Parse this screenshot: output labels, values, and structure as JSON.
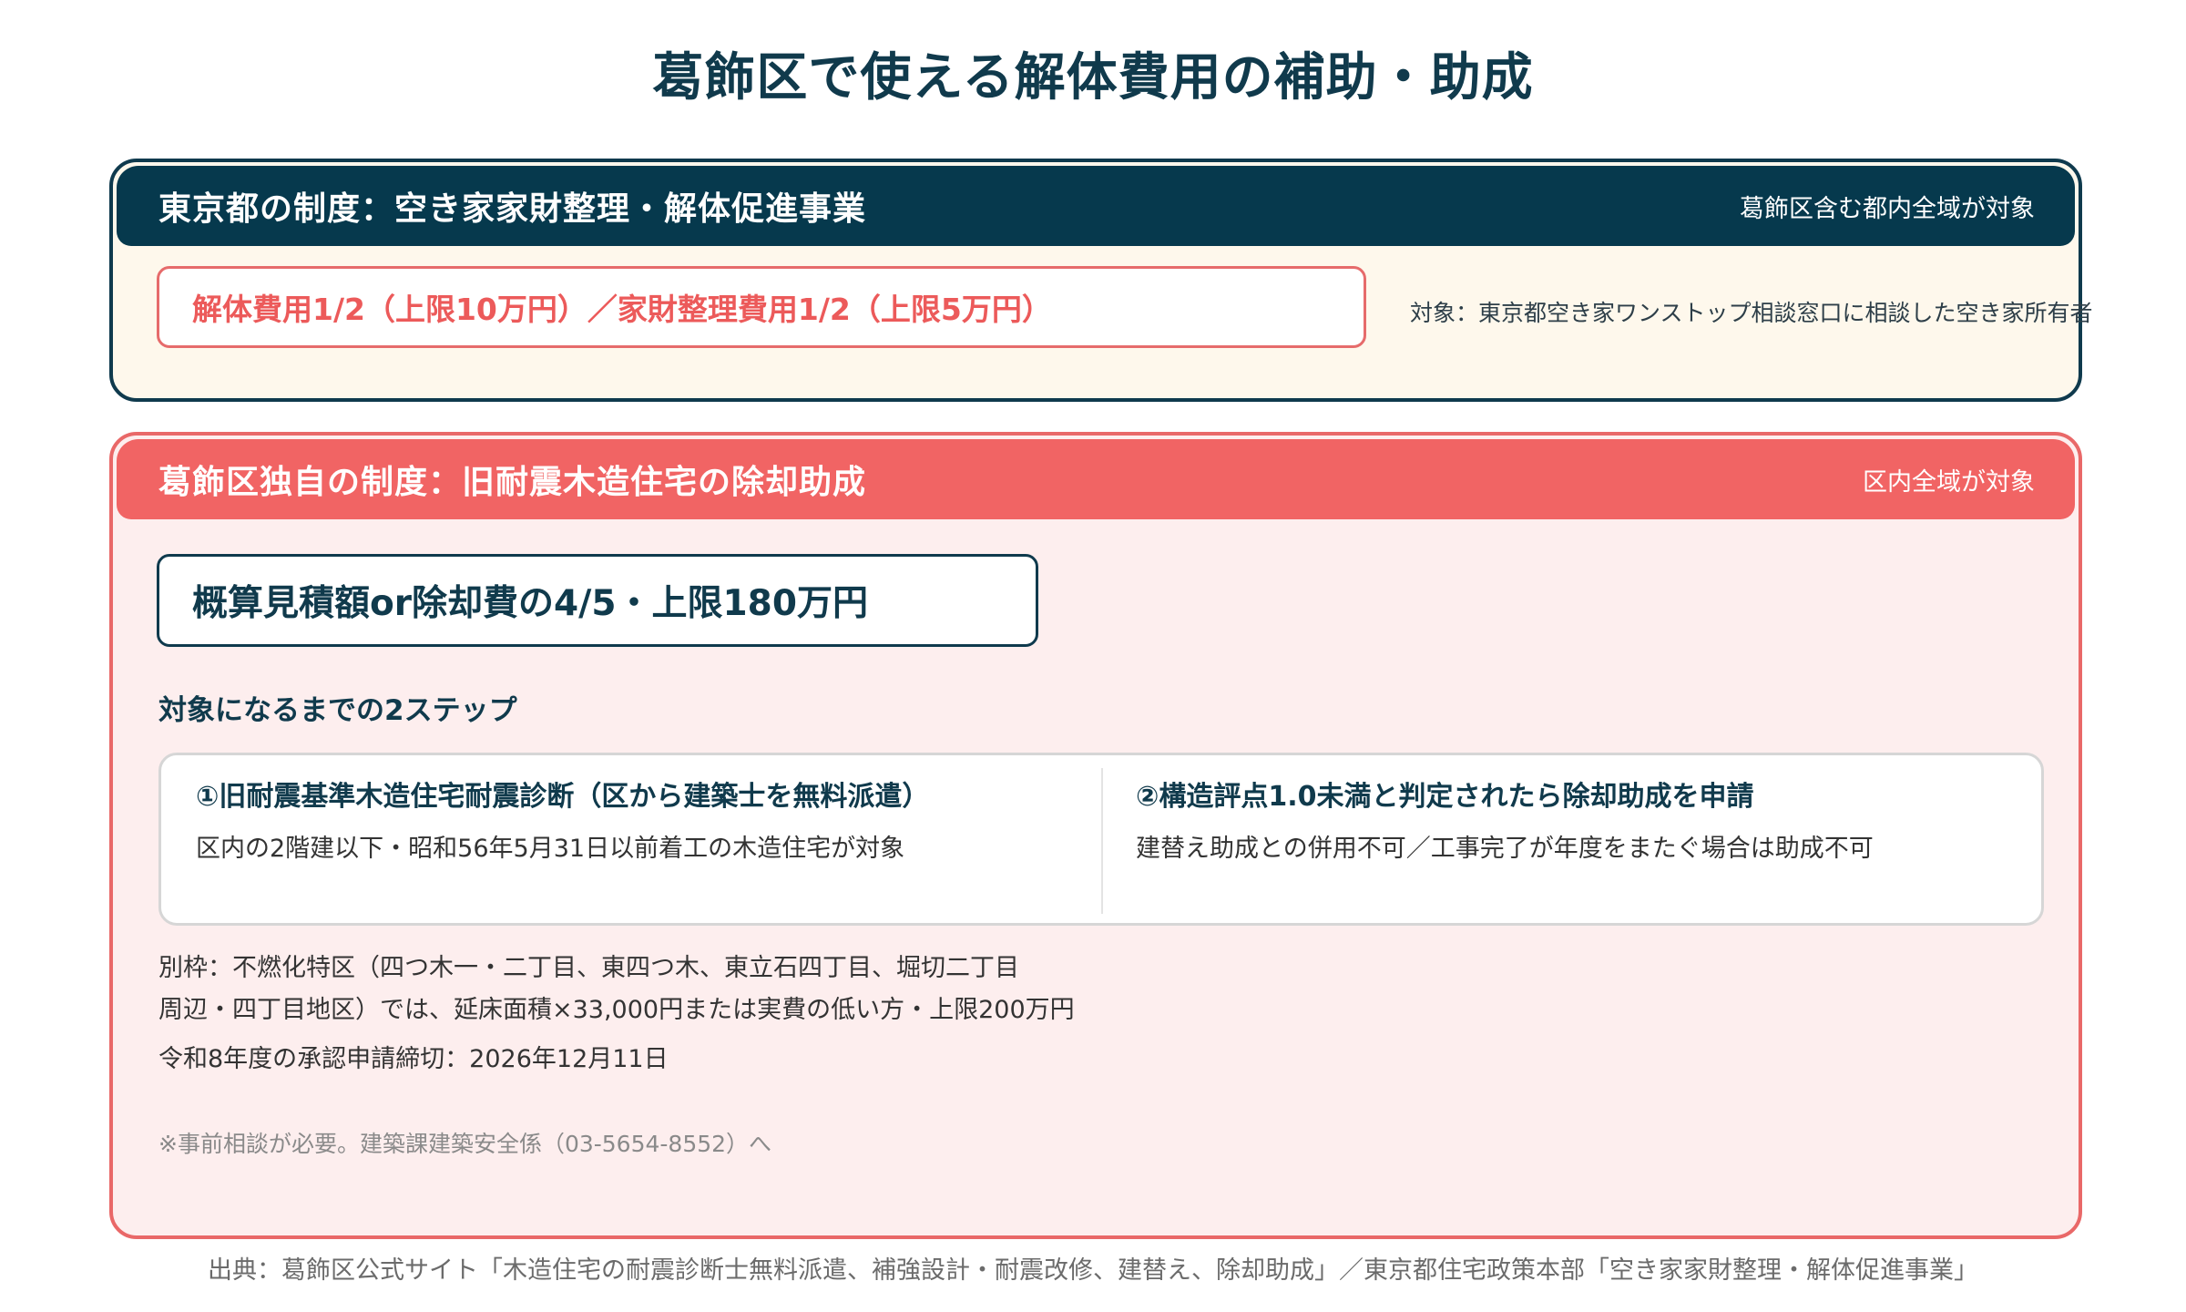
{
  "title": "葛飾区で使える解体費用の補助・助成",
  "tokyo": {
    "heading": "東京都の制度：空き家家財整理・解体促進事業",
    "scope": "葛飾区含む都内全域が対象",
    "benefit": "解体費用1/2（上限10万円）／家財整理費用1/2（上限5万円）",
    "target": "対象：東京都空き家ワンストップ相談窓口に相談した空き家所有者"
  },
  "katsushika": {
    "heading": "葛飾区独自の制度：旧耐震木造住宅の除却助成",
    "scope": "区内全域が対象",
    "benefit": "概算見積額or除却費の4/5・上限180万円",
    "steps_heading": "対象になるまでの2ステップ",
    "steps": [
      {
        "title": "①旧耐震基準木造住宅耐震診断（区から建築士を無料派遣）",
        "desc": "区内の2階建以下・昭和56年5月31日以前着工の木造住宅が対象"
      },
      {
        "title": "②構造評点1.0未満と判定されたら除却助成を申請",
        "desc": "建替え助成との併用不可／工事完了が年度をまたぐ場合は助成不可"
      }
    ],
    "note_line1": "別枠：不燃化特区（四つ木一・二丁目、東四つ木、東立石四丁目、堀切二丁目",
    "note_line2": "周辺・四丁目地区）では、延床面積×33,000円または実費の低い方・上限200万円",
    "deadline": "令和8年度の承認申請締切：2026年12月11日",
    "fineprint": "※事前相談が必要。建築課建築安全係（03-5654-8552）へ"
  },
  "source": "出典：葛飾区公式サイト「木造住宅の耐震診断士無料派遣、補強設計・耐震改修、建替え、除却助成」／東京都住宅政策本部「空き家家財整理・解体促進事業」",
  "colors": {
    "navy": "#06394d",
    "coral": "#f16464",
    "cream": "#fef8ec",
    "pink": "#fdeeee"
  }
}
